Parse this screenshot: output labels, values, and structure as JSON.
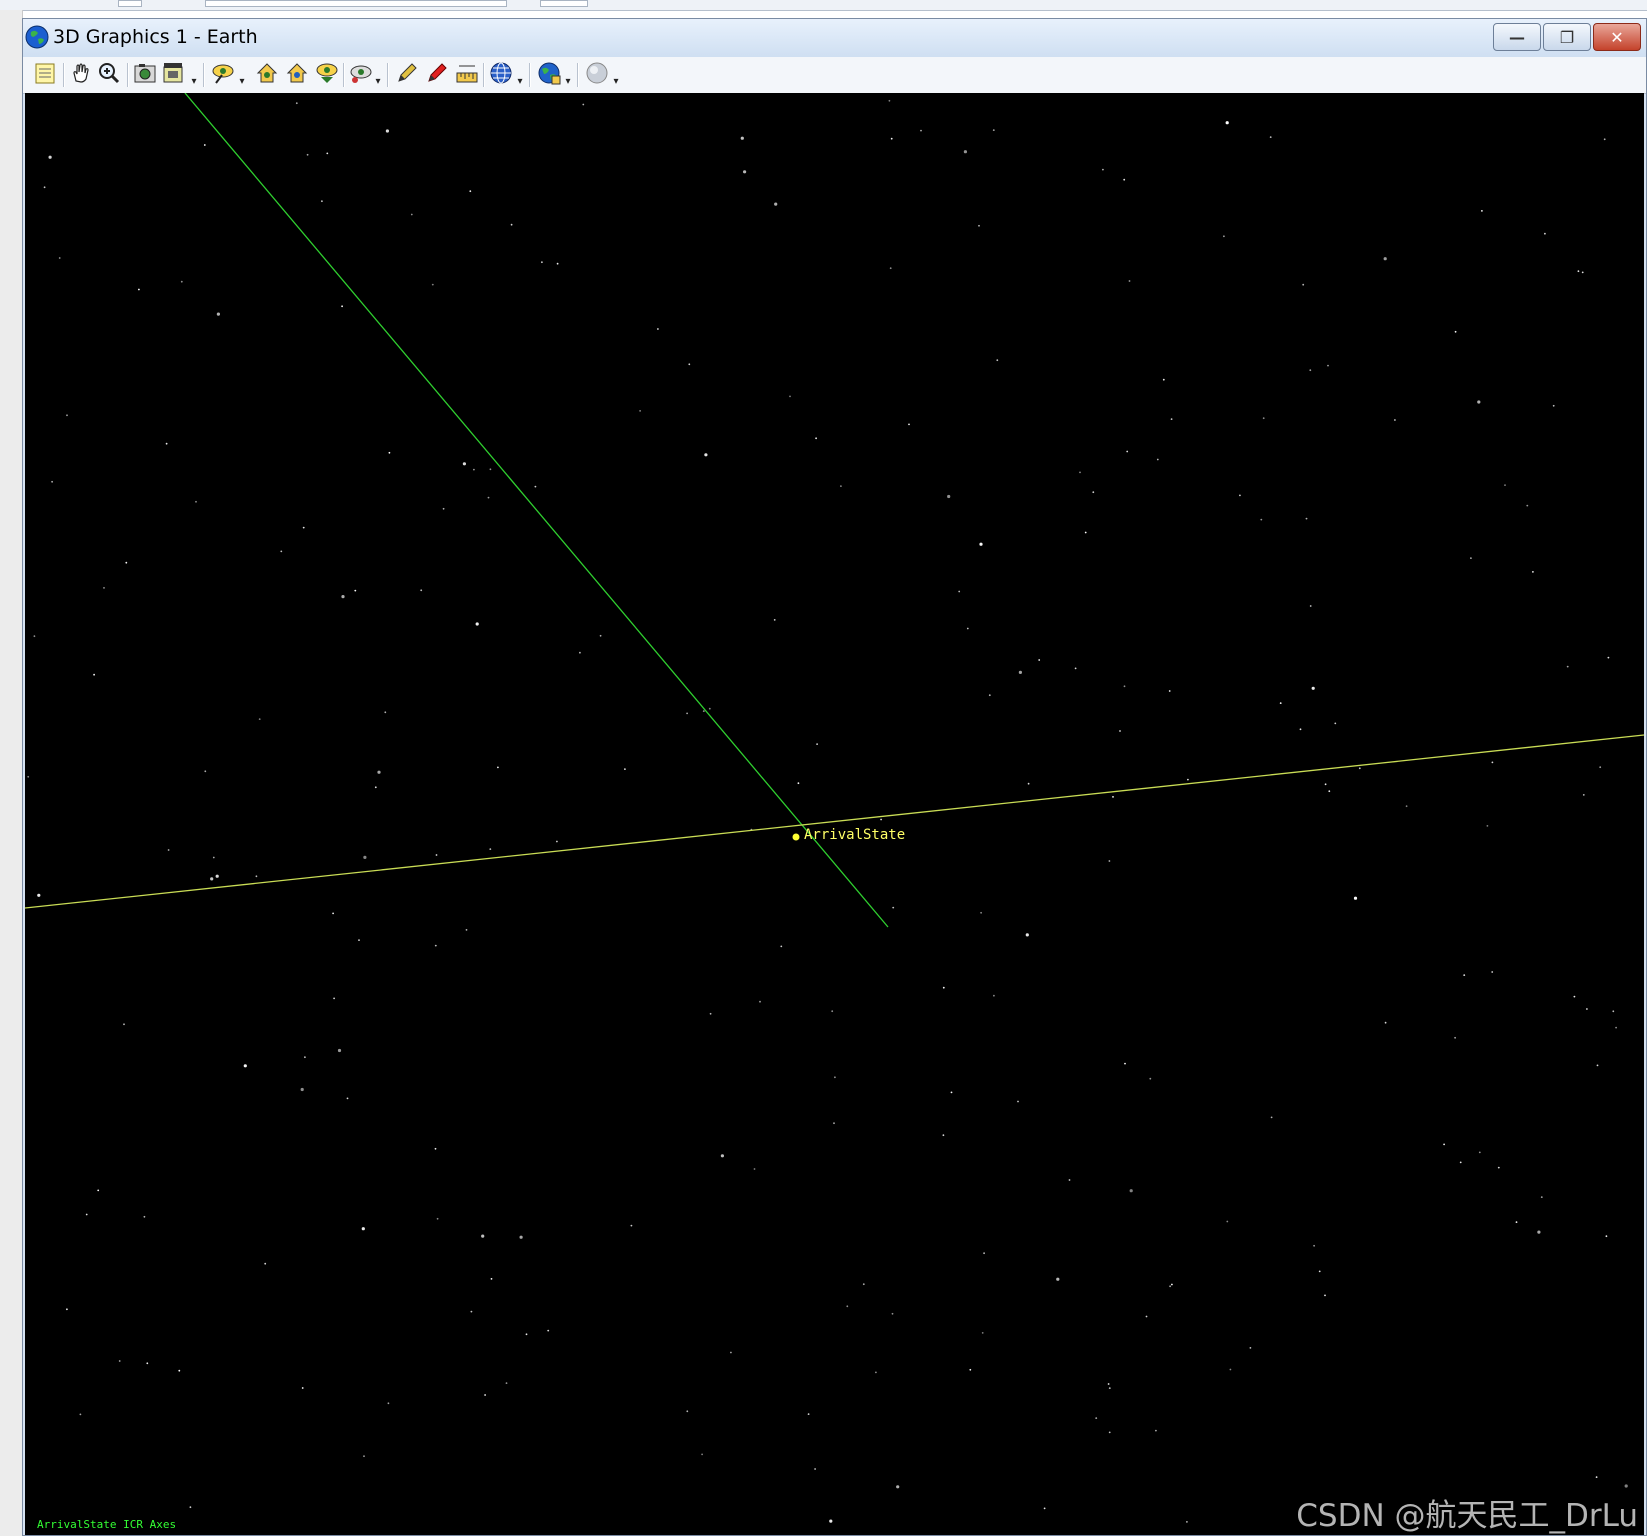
{
  "window": {
    "title": "3D Graphics 1 - Earth",
    "minimize_label": "—",
    "restore_label": "❐",
    "close_label": "✕"
  },
  "toolbar": {
    "items": [
      {
        "icon": "properties-icon"
      },
      {
        "icon": "pan-hand-icon"
      },
      {
        "icon": "zoom-icon"
      },
      {
        "icon": "snapshot-icon"
      },
      {
        "icon": "record-movie-icon"
      },
      {
        "icon": "view-from-to-icon"
      },
      {
        "icon": "home-view-icon"
      },
      {
        "icon": "home-view-alt-icon"
      },
      {
        "icon": "orient-view-icon"
      },
      {
        "icon": "tracking-view-icon"
      },
      {
        "icon": "pencil-icon"
      },
      {
        "icon": "red-pencil-icon"
      },
      {
        "icon": "measure-ruler-icon"
      },
      {
        "icon": "globe-grid-icon"
      },
      {
        "icon": "globe-object-icon"
      },
      {
        "icon": "sphere-icon"
      }
    ]
  },
  "viewport": {
    "object_label": "ArrivalState",
    "axes_info": "ArrivalState ICR Axes",
    "watermark": "CSDN @航天民工_DrLu",
    "colors": {
      "background": "#000000",
      "green_axis": "#2fcf2f",
      "yellow_axis": "#d4e85a",
      "label": "#ffff66",
      "stars": "#ffffff"
    }
  }
}
